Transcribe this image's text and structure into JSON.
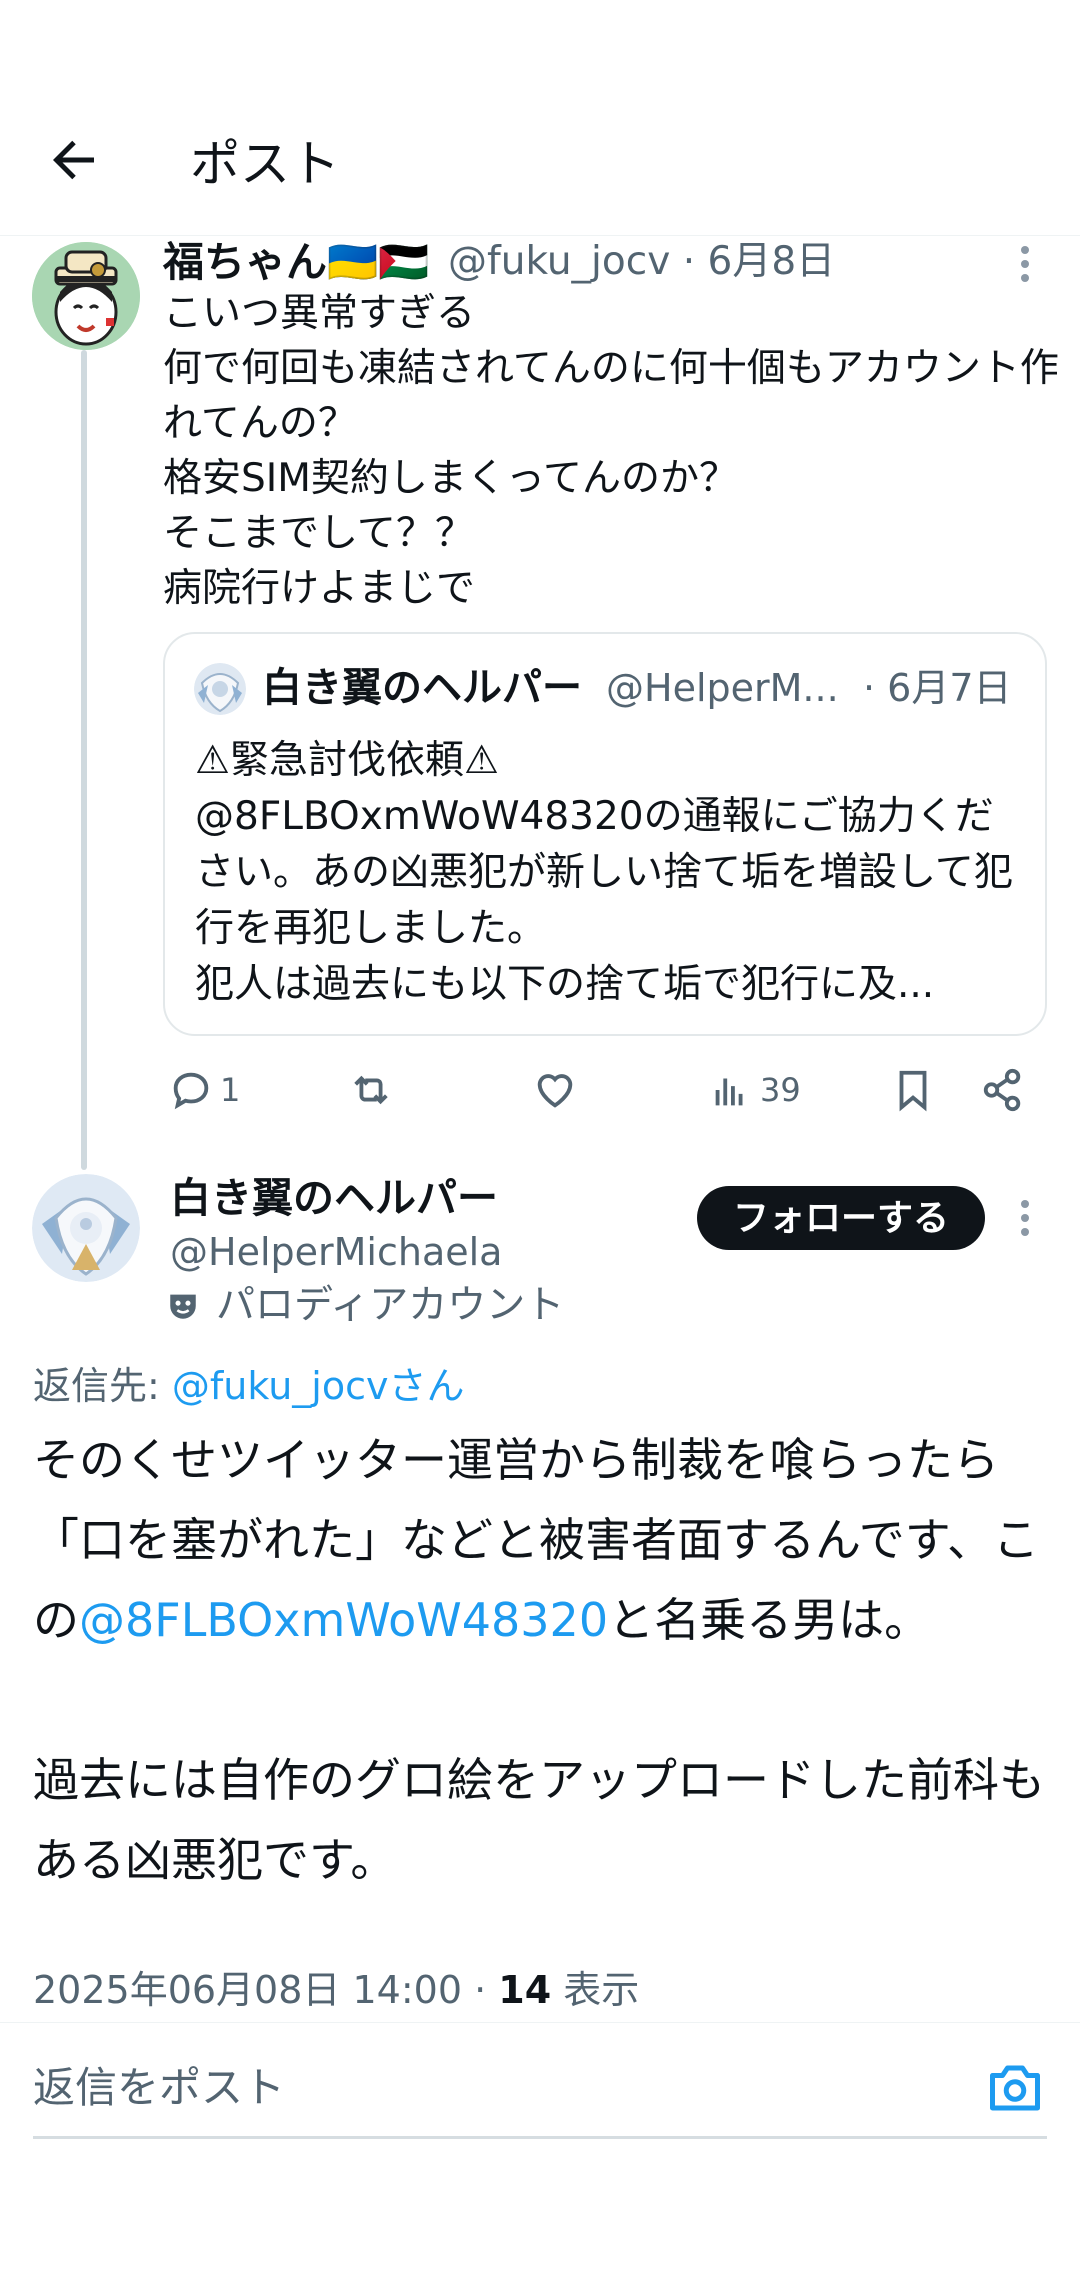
{
  "header": {
    "title": "ポスト"
  },
  "post1": {
    "name": "福ちゃん🇺🇦🇵🇸",
    "handle": "@fuku_jocv",
    "date": "6月8日",
    "text": "こいつ異常すぎる\n何で何回も凍結されてんのに何十個もアカウント作れてんの？\n格安SIM契約しまくってんのか？\nそこまでして？？\n病院行けよまじで",
    "quote": {
      "name": "白き翼のヘルパー",
      "handle": "@HelperM...",
      "date": "· 6月7日",
      "text": "⚠緊急討伐依頼⚠\n@8FLBOxmWoW48320の通報にご協力ください。あの凶悪犯が新しい捨て垢を増設して犯行を再犯しました。\n犯人は過去にも以下の捨て垢で犯行に及..."
    },
    "actions": {
      "replies": "1",
      "views": "39"
    }
  },
  "post2": {
    "name": "白き翼のヘルパー",
    "handle": "@HelperMichaela",
    "parody_label": "パロディアカウント",
    "follow_label": "フォローする",
    "reply_prefix": "返信先: ",
    "reply_to": "@fuku_jocvさん",
    "text_part1": "そのくせツイッター運営から制裁を喰らったら「口を塞がれた」などと被害者面するんです、この",
    "mention": "@8FLBOxmWoW48320",
    "text_part2": "と名乗る男は。\n\n過去には自作のグロ絵をアップロードした前科もある凶悪犯です。",
    "timestamp": "2025年06月08日 14:00 · ",
    "views_count": "14",
    "views_label": " 表示"
  },
  "reply_box": {
    "placeholder": "返信をポスト"
  },
  "colors": {
    "accent": "#1d9bf0",
    "text": "#0f1419",
    "secondary": "#536471"
  }
}
